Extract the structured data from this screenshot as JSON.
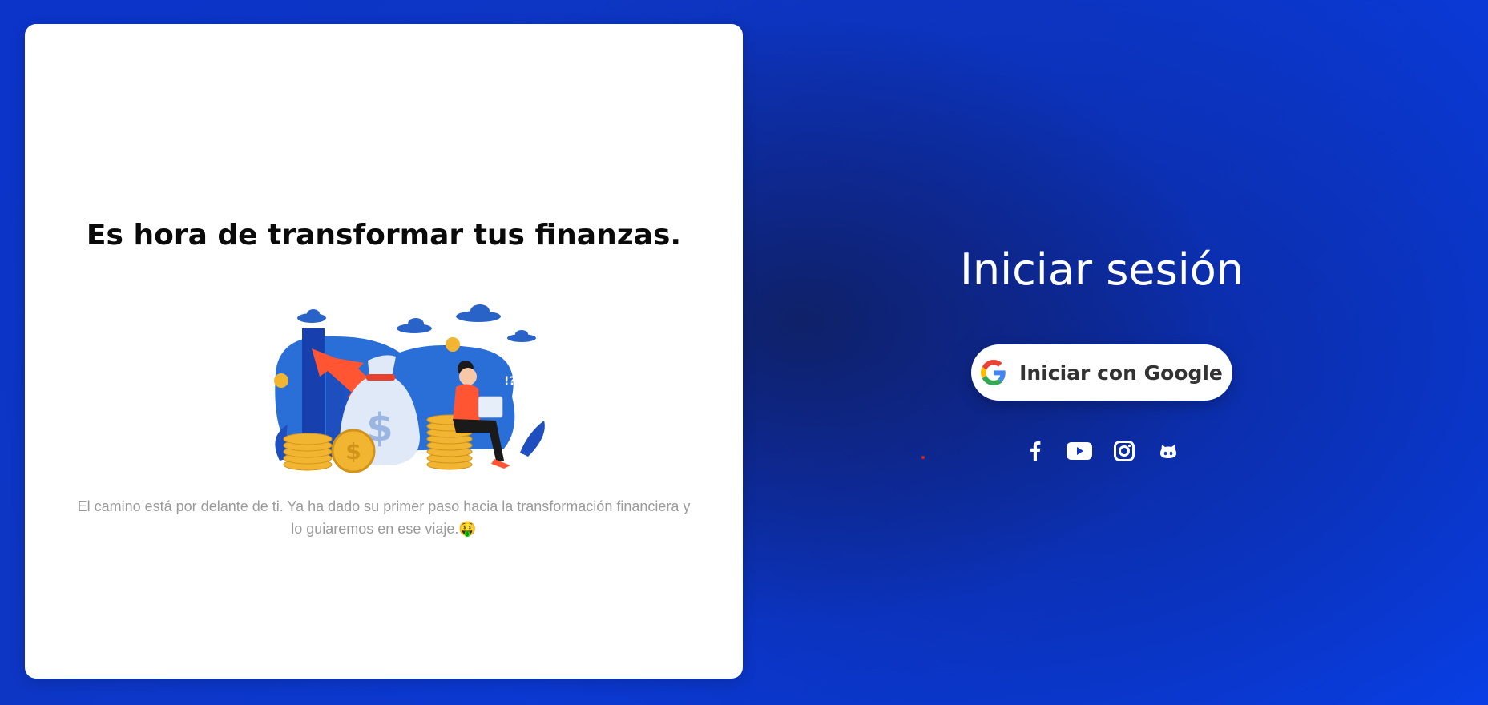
{
  "left_panel": {
    "title": "Es hora de transformar tus finanzas.",
    "description": "El camino está por delante de ti. Ya ha dado su primer paso hacia la transformación financiera y lo guiaremos en ese viaje.🤑",
    "illustration": "finance-illustration"
  },
  "login": {
    "title": "Iniciar sesión",
    "google_button_label": "Iniciar con Google",
    "google_icon": "google-icon"
  },
  "social_links": [
    {
      "icon": "facebook-icon"
    },
    {
      "icon": "youtube-icon"
    },
    {
      "icon": "instagram-icon"
    },
    {
      "icon": "github-icon"
    }
  ],
  "colors": {
    "background": "#0c34c9",
    "card": "#ffffff",
    "accent_red": "#e02020"
  }
}
